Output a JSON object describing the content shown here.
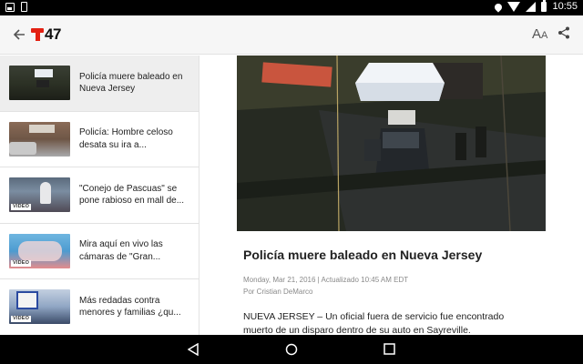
{
  "status_bar": {
    "time": "10:55",
    "icons": [
      "image-icon",
      "phone-icon",
      "location-icon",
      "wifi-icon",
      "signal-icon",
      "battery-icon"
    ]
  },
  "app_bar": {
    "logo_text": "47",
    "brand_color": "#e32012",
    "font_size_label_big": "A",
    "font_size_label_small": "A"
  },
  "sidebar": {
    "items": [
      {
        "title": "Policía muere baleado en Nueva Jersey",
        "video": false,
        "selected": true
      },
      {
        "title": "Policía: Hombre celoso desata su ira a...",
        "video": false,
        "selected": false
      },
      {
        "title": "\"Conejo de Pascuas\" se pone rabioso en mall de...",
        "video": true,
        "selected": false
      },
      {
        "title": "Mira aquí en vivo las cámaras de \"Gran...",
        "video": true,
        "selected": false
      },
      {
        "title": "Más redadas contra menores y familias ¿qu...",
        "video": true,
        "selected": false
      }
    ],
    "video_label": "VIDEO"
  },
  "article": {
    "title": "Policía muere baleado en Nueva Jersey",
    "date": "Monday, Mar 21, 2016 | Actualizado 10:45 AM EDT",
    "author": "Por Cristian DeMarco",
    "body": "NUEVA JERSEY – Un oficial fuera de servicio fue encontrado muerto de un disparo dentro de su auto en Sayreville."
  }
}
